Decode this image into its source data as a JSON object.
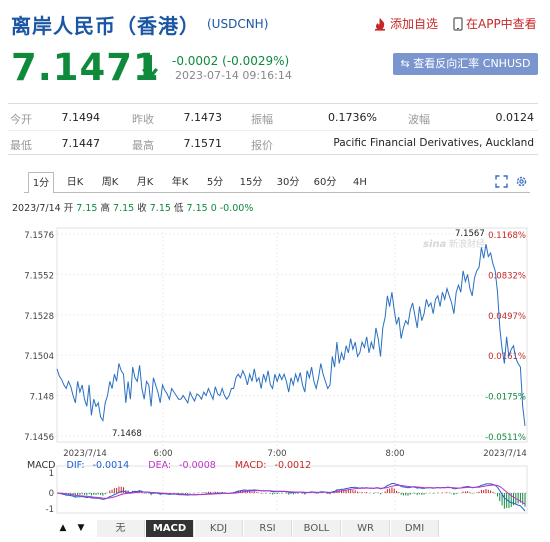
{
  "header": {
    "title": "离岸人民币（香港）",
    "code": "(USDCNH)",
    "add_watch": "添加自选",
    "app_view": "在APP中查看"
  },
  "quote": {
    "price": "7.1471",
    "change": "-0.0002 (-0.0029%)",
    "timestamp": "2023-07-14 09:16:14",
    "reverse_button": "查看反向汇率 CNHUSD",
    "down_color": "#0f8a3c"
  },
  "stats": {
    "open_label": "今开",
    "open": "7.1494",
    "prev_close_label": "昨收",
    "prev_close": "7.1473",
    "amplitude_label": "振幅",
    "amplitude": "0.1736%",
    "wave_label": "波幅",
    "wave": "0.0124",
    "low_label": "最低",
    "low": "7.1447",
    "high_label": "最高",
    "high": "7.1571",
    "quote_src_label": "报价",
    "quote_src": "Pacific Financial Derivatives, Auckland"
  },
  "tabs": [
    "1分",
    "日K",
    "周K",
    "月K",
    "年K",
    "5分",
    "15分",
    "30分",
    "60分",
    "4H"
  ],
  "info_line": {
    "date": "2023/7/14",
    "open_label": "开",
    "open": "7.15",
    "high_label": "高",
    "high": "7.15",
    "close_label": "收",
    "close": "7.15",
    "low_label": "低",
    "low": "7.15",
    "change": "0 -0.00%"
  },
  "chart_data": {
    "type": "line",
    "y_ticks": [
      "7.1576",
      "7.1552",
      "7.1528",
      "7.1504",
      "7.148",
      "7.1456"
    ],
    "pct_ticks": [
      "0.1168%",
      "0.0832%",
      "0.0497%",
      "0.0161%",
      "-0.0175%",
      "-0.0511%"
    ],
    "x_ticks": [
      "2023/7/14",
      "6:00",
      "7:00",
      "8:00",
      "2023/7/14"
    ],
    "ylim": [
      7.1456,
      7.1576
    ],
    "max_label": "7.1567",
    "min_label": "7.1468",
    "prev_close": 7.1473,
    "line_color": "#2a6fc0",
    "series": [
      {
        "values": [
          7.1497,
          7.1493,
          7.1491,
          7.1488,
          7.1486,
          7.149,
          7.1487,
          7.1482,
          7.1478,
          7.149,
          7.1484,
          7.1488,
          7.148,
          7.1476,
          7.1488,
          7.1471,
          7.148,
          7.1476,
          7.1478,
          7.147,
          7.1468,
          7.1478,
          7.1482,
          7.149,
          7.1486,
          7.1494,
          7.149,
          7.15,
          7.1496,
          7.1494,
          7.1478,
          7.149,
          7.148,
          7.1498,
          7.1492,
          7.149,
          7.1499,
          7.1486,
          7.148,
          7.149,
          7.1488,
          7.1476,
          7.1492,
          7.1488,
          7.1484,
          7.1478,
          7.1488,
          7.1485,
          7.1483,
          7.148,
          7.1486,
          7.1484,
          7.1482,
          7.148,
          7.148,
          7.1482,
          7.148,
          7.1478,
          7.1484,
          7.1481,
          7.1479,
          7.1483,
          7.1482,
          7.148,
          7.1484,
          7.1482,
          7.1486,
          7.1483,
          7.148,
          7.1487,
          7.1483,
          7.1482,
          7.1486,
          7.1482,
          7.148,
          7.1482,
          7.1486,
          7.1486,
          7.1492,
          7.1494,
          7.1492,
          7.1496,
          7.1493,
          7.1488,
          7.1494,
          7.149,
          7.1497,
          7.149,
          7.1492,
          7.1486,
          7.1494,
          7.149,
          7.1496,
          7.1488,
          7.1486,
          7.1494,
          7.149,
          7.1494,
          7.1491,
          7.1494,
          7.149,
          7.1484,
          7.1492,
          7.1488,
          7.1494,
          7.149,
          7.1495,
          7.1488,
          7.1484,
          7.1496,
          7.1492,
          7.1498,
          7.149,
          7.1486,
          7.1492,
          7.15,
          7.1494,
          7.149,
          7.1486,
          7.1488,
          7.1504,
          7.1498,
          7.1512,
          7.15,
          7.1506,
          7.1502,
          7.151,
          7.1506,
          7.1514,
          7.1508,
          7.1512,
          7.1504,
          7.1506,
          7.1512,
          7.1509,
          7.1515,
          7.1506,
          7.1512,
          7.1508,
          7.152,
          7.1514,
          7.1504,
          7.152,
          7.1526,
          7.1538,
          7.1532,
          7.154,
          7.153,
          7.1522,
          7.1526,
          7.1514,
          7.152,
          7.1524,
          7.1522,
          7.153,
          7.1534,
          7.1527,
          7.152,
          7.1532,
          7.1524,
          7.1528,
          7.1536,
          7.1532,
          7.1534,
          7.1528,
          7.1536,
          7.1538,
          7.1532,
          7.154,
          7.1536,
          7.1542,
          7.1538,
          7.1534,
          7.1528,
          7.154,
          7.1544,
          7.154,
          7.1552,
          7.1546,
          7.155,
          7.1542,
          7.1538,
          7.1548,
          7.1552,
          7.1554,
          7.1565,
          7.1559,
          7.1567,
          7.156,
          7.1562,
          7.1556,
          7.1552,
          7.154,
          7.152,
          7.1508,
          7.15,
          7.1515,
          7.1504,
          7.1508,
          7.151,
          7.1503,
          7.15,
          7.1498,
          7.1476,
          7.1465
        ]
      }
    ],
    "macd": {
      "labels": [
        "MACD",
        "DIF:",
        "-0.0014",
        "DEA:",
        "-0.0008",
        "MACD:",
        "-0.0012"
      ],
      "dif_color": "#1f5fd0",
      "dea_color": "#c031c7",
      "macd_color": "#c62828",
      "y_ticks": [
        "1",
        "0",
        "-1"
      ]
    }
  },
  "bottom_tabs": [
    "无",
    "MACD",
    "KDJ",
    "RSI",
    "BOLL",
    "WR",
    "DMI"
  ],
  "icons": {
    "fullscreen": "fullscreen-icon",
    "settings": "settings-icon",
    "add": "fire-icon",
    "app": "phone-icon"
  }
}
